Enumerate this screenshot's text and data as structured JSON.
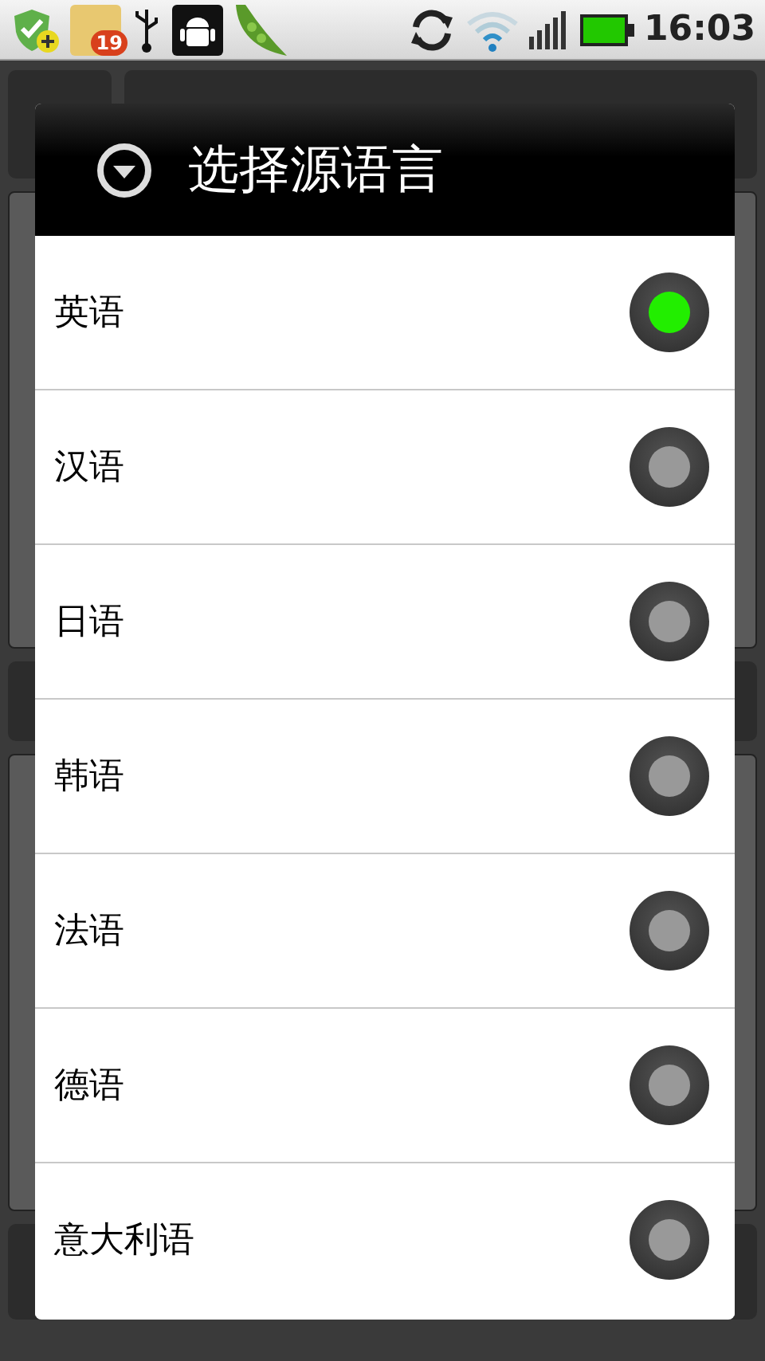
{
  "status_bar": {
    "calendar_badge": "19",
    "time": "16:03"
  },
  "dialog": {
    "title": "选择源语言",
    "options": [
      {
        "label": "英语",
        "selected": true
      },
      {
        "label": "汉语",
        "selected": false
      },
      {
        "label": "日语",
        "selected": false
      },
      {
        "label": "韩语",
        "selected": false
      },
      {
        "label": "法语",
        "selected": false
      },
      {
        "label": "德语",
        "selected": false
      },
      {
        "label": "意大利语",
        "selected": false
      }
    ]
  }
}
